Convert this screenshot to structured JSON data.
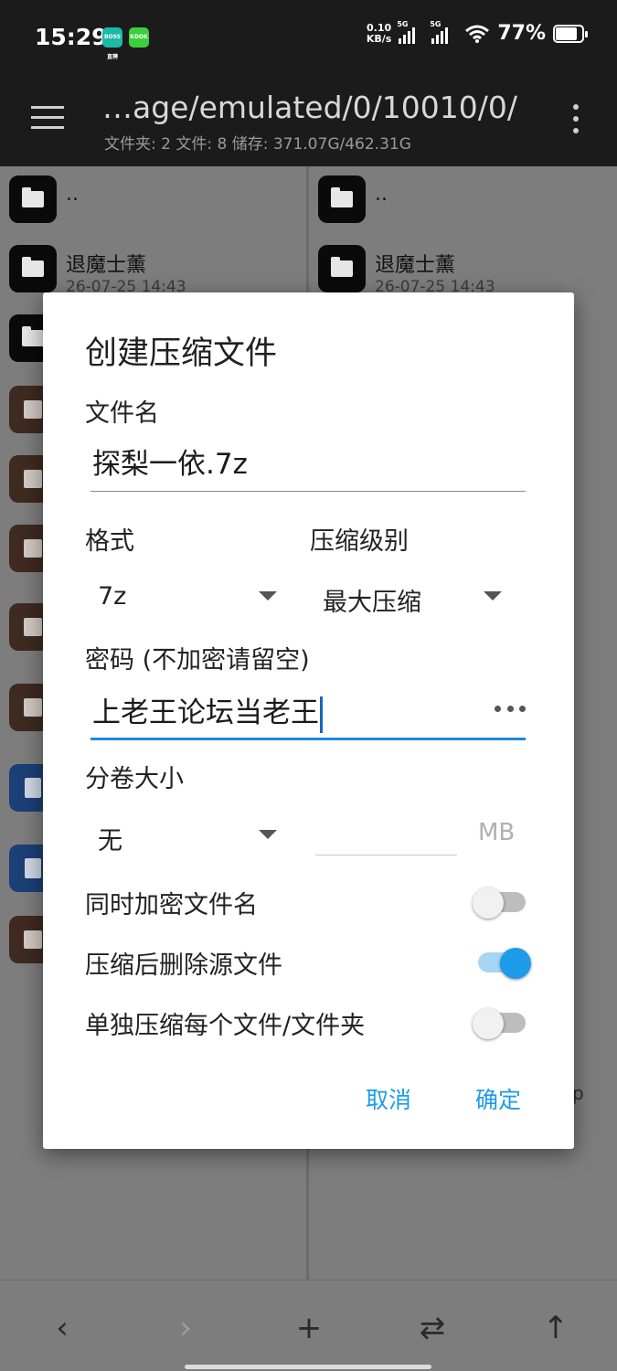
{
  "status_bar": {
    "time": "15:29",
    "app_icons": [
      "BOSS直聘",
      "KDOK"
    ],
    "net_speed_value": "0.10",
    "net_speed_unit": "KB/s",
    "signal_1": "5G",
    "signal_2": "5G",
    "battery_percent": "77%",
    "battery_level": 0.77
  },
  "app_bar": {
    "path": "…age/emulated/0/10010/0/",
    "summary": "文件夹: 2  文件: 8  储存: 371.07G/462.31G"
  },
  "left_pane": {
    "items": [
      {
        "name": "..",
        "date": "",
        "type": "folder"
      },
      {
        "name": "退魔士薰",
        "date": "26-07-25 14:43",
        "type": "folder"
      }
    ]
  },
  "right_pane": {
    "items": [
      {
        "name": "..",
        "date": "",
        "type": "folder"
      },
      {
        "name": "退魔士薰",
        "date": "26-07-25 14:43",
        "type": "folder"
      }
    ],
    "stray_text": "p"
  },
  "dialog": {
    "title": "创建压缩文件",
    "filename_label": "文件名",
    "filename_value": "探梨一依.7z",
    "format_label": "格式",
    "format_value": "7z",
    "level_label": "压缩级别",
    "level_value": "最大压缩",
    "password_label": "密码 (不加密请留空)",
    "password_value": "上老王论坛当老王",
    "split_label": "分卷大小",
    "split_value": "无",
    "split_unit": "MB",
    "switches": [
      {
        "label": "同时加密文件名",
        "on": false
      },
      {
        "label": "压缩后删除源文件",
        "on": true
      },
      {
        "label": "单独压缩每个文件/文件夹",
        "on": false
      }
    ],
    "cancel": "取消",
    "ok": "确定"
  },
  "bottom_nav": {
    "back": "‹",
    "forward": "›",
    "add": "+",
    "swap": "⇄",
    "up": "↑"
  },
  "colors": {
    "accent": "#1e9be9",
    "scrim_pane": "#7d7d7d",
    "dark_bar": "#1b1b1b"
  }
}
